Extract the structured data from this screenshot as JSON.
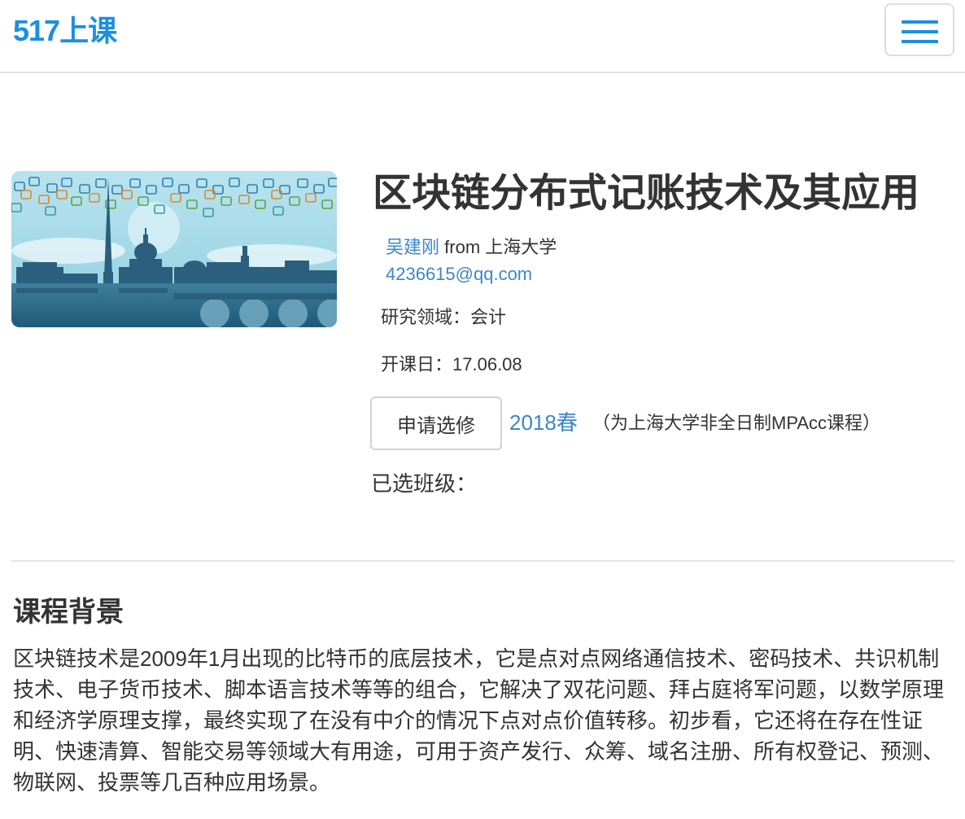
{
  "header": {
    "brand": "517上课",
    "menu_icon": "hamburger-menu-icon",
    "accent_color": "#1a8fe3"
  },
  "course": {
    "title": "区块链分布式记账技术及其应用",
    "image_icon": "washington-skyline-blockchain-illustration",
    "teacher_name": "吴建刚",
    "from_word": "from",
    "institution": "上海大学",
    "email": "4236615@qq.com",
    "research_field_label": "研究领域：",
    "research_field_value": "会计",
    "start_date_label": "开课日：",
    "start_date_value": "17.06.08",
    "apply_button": "申请选修",
    "term": "2018春",
    "term_note": "（为上海大学非全日制MPAcc课程）",
    "selected_class_label": "已选班级："
  },
  "background": {
    "title": "课程背景",
    "body": "区块链技术是2009年1月出现的比特币的底层技术，它是点对点网络通信技术、密码技术、共识机制技术、电子货币技术、脚本语言技术等等的组合，它解决了双花问题、拜占庭将军问题，以数学原理和经济学原理支撑，最终实现了在没有中介的情况下点对点价值转移。初步看，它还将在存在性证明、快速清算、智能交易等领域大有用途，可用于资产发行、众筹、域名注册、所有权登记、预测、物联网、投票等几百种应用场景。"
  },
  "colors": {
    "link": "#3c87c7",
    "text": "#333333"
  }
}
